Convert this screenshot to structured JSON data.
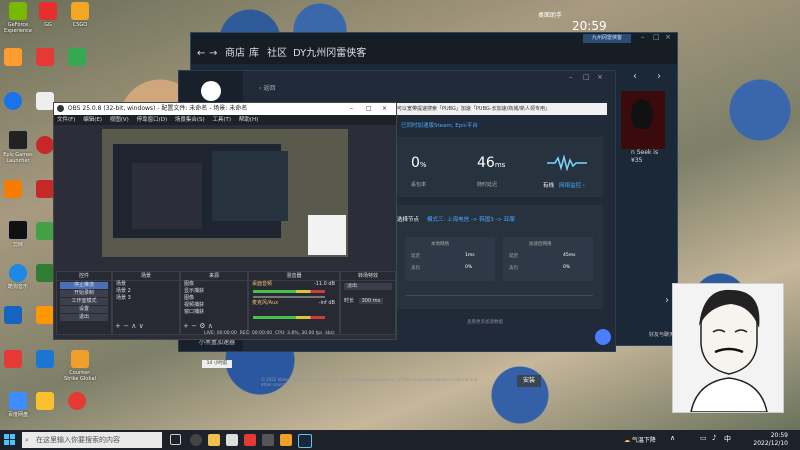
{
  "desktop": {
    "icons": [
      {
        "label": "GeForce Experience",
        "color": "#76b900"
      },
      {
        "label": "GG",
        "color": "#e62e2e"
      },
      {
        "label": "CSGO",
        "color": "#f5a623"
      },
      {
        "label": "Epic Games Launcher",
        "color": "#222222"
      },
      {
        "label": "剪映",
        "color": "#111111"
      },
      {
        "label": "酷狗音乐",
        "color": "#1e88e5"
      },
      {
        "label": "Counter-Strike Global",
        "color": "#f0a02a"
      },
      {
        "label": "百度网盘",
        "color": "#3f8cff"
      }
    ]
  },
  "taskbar": {
    "search_placeholder": "在这里输入你要搜索的内容",
    "weather": "气温下降",
    "time": "20:59",
    "date": "2022/12/10"
  },
  "widget": {
    "label": "桌面助手",
    "time": "20:59"
  },
  "steam": {
    "nav": {
      "store": "商店",
      "library": "库",
      "community": "社区",
      "user": "DY九州冈雷侠客"
    },
    "user_badge": "九州冈雷侠客",
    "footer": "© 2022 Valve Corporation and Ubisoft. All trademarks are property of their respective owners in the US and other countries.",
    "install": "安装",
    "game_title": "n Seek is",
    "game_price": "¥35",
    "friends": "好友与聊天"
  },
  "accelerator": {
    "back": "返回",
    "notice": "可以宽带提速搜索「PUBG」加速「PUBG-长加速/商城/新人领专用」",
    "platform": "已同时加速版Steam, Epic平台",
    "loss_value": "0",
    "loss_unit": "%",
    "loss_label": "丢包率",
    "ping_value": "46",
    "ping_unit": "ms",
    "ping_label": "随时延迟",
    "net_label": "有线",
    "net_monitor": "网络监控",
    "node_label": "选择节点",
    "mode": "模式三: 上海电信 -> 韩国3 -> 亚服",
    "local_header": "本地网络",
    "accel_header": "加速后网络",
    "delay_label": "延迟",
    "loss_row_label": "丢包",
    "local_delay": "1ms",
    "local_loss": "0%",
    "accel_delay": "45ms",
    "accel_loss": "0%",
    "expand": "查看更多加速数据",
    "bottom": "小黑盒加速器"
  },
  "obs": {
    "title": "OBS 25.0.8 (32-bit, windows) - 配置文件: 未命名 - 场景: 未命名",
    "menu": [
      "文件(F)",
      "编辑(E)",
      "视图(V)",
      "停靠窗口(D)",
      "场景集合(S)",
      "工具(T)",
      "帮助(H)"
    ],
    "docks": {
      "controls": "控件",
      "scenes": "场景",
      "sources": "来源",
      "mixer": "混音器",
      "transitions": "转场特效"
    },
    "controls": [
      "停止推流",
      "开始录制",
      "工作室模式",
      "设置",
      "退出"
    ],
    "scenes": [
      "场景",
      "场景 2",
      "场景 3"
    ],
    "sources": [
      "图像",
      "显示捕获",
      "图像",
      "视频捕获",
      "窗口捕获"
    ],
    "mixer": [
      {
        "name": "桌面音频",
        "db": "-11.0 dB"
      },
      {
        "name": "麦克风/Aux",
        "db": "-inf dB"
      }
    ],
    "transition": {
      "type": "淡出",
      "duration_label": "时长",
      "duration": "300 ms"
    },
    "status": {
      "live": "LIVE: 00:00:00",
      "rec": "REC: 00:00:00",
      "cpu": "CPU: 3.8%, 30.00 fps",
      "bitrate": "kb/s"
    }
  },
  "taskbar_extra": {
    "notice": "14 小时前"
  }
}
